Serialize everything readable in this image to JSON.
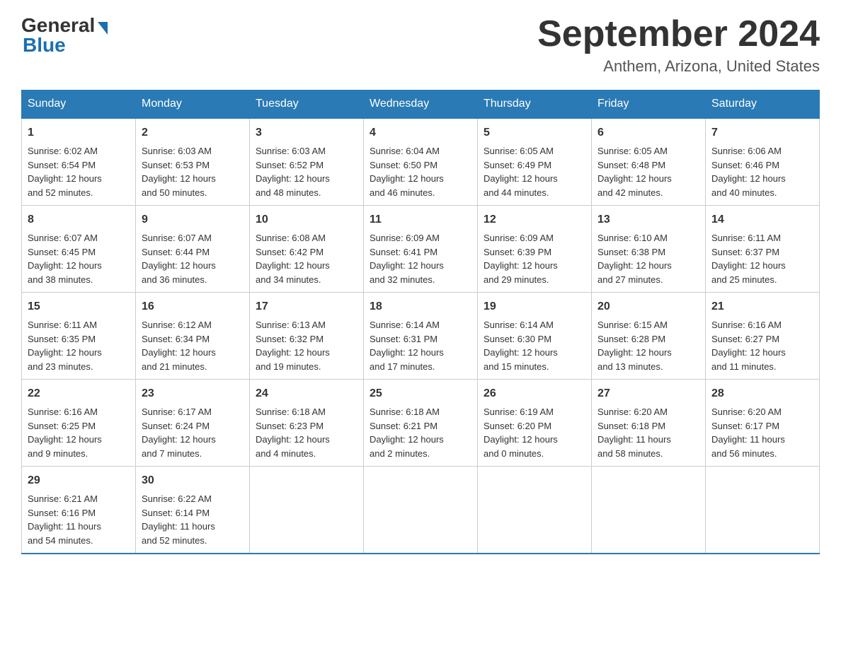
{
  "header": {
    "logo_general": "General",
    "logo_blue": "Blue",
    "title": "September 2024",
    "subtitle": "Anthem, Arizona, United States"
  },
  "days_of_week": [
    "Sunday",
    "Monday",
    "Tuesday",
    "Wednesday",
    "Thursday",
    "Friday",
    "Saturday"
  ],
  "weeks": [
    [
      {
        "day": "1",
        "sunrise": "6:02 AM",
        "sunset": "6:54 PM",
        "daylight": "12 hours and 52 minutes."
      },
      {
        "day": "2",
        "sunrise": "6:03 AM",
        "sunset": "6:53 PM",
        "daylight": "12 hours and 50 minutes."
      },
      {
        "day": "3",
        "sunrise": "6:03 AM",
        "sunset": "6:52 PM",
        "daylight": "12 hours and 48 minutes."
      },
      {
        "day": "4",
        "sunrise": "6:04 AM",
        "sunset": "6:50 PM",
        "daylight": "12 hours and 46 minutes."
      },
      {
        "day": "5",
        "sunrise": "6:05 AM",
        "sunset": "6:49 PM",
        "daylight": "12 hours and 44 minutes."
      },
      {
        "day": "6",
        "sunrise": "6:05 AM",
        "sunset": "6:48 PM",
        "daylight": "12 hours and 42 minutes."
      },
      {
        "day": "7",
        "sunrise": "6:06 AM",
        "sunset": "6:46 PM",
        "daylight": "12 hours and 40 minutes."
      }
    ],
    [
      {
        "day": "8",
        "sunrise": "6:07 AM",
        "sunset": "6:45 PM",
        "daylight": "12 hours and 38 minutes."
      },
      {
        "day": "9",
        "sunrise": "6:07 AM",
        "sunset": "6:44 PM",
        "daylight": "12 hours and 36 minutes."
      },
      {
        "day": "10",
        "sunrise": "6:08 AM",
        "sunset": "6:42 PM",
        "daylight": "12 hours and 34 minutes."
      },
      {
        "day": "11",
        "sunrise": "6:09 AM",
        "sunset": "6:41 PM",
        "daylight": "12 hours and 32 minutes."
      },
      {
        "day": "12",
        "sunrise": "6:09 AM",
        "sunset": "6:39 PM",
        "daylight": "12 hours and 29 minutes."
      },
      {
        "day": "13",
        "sunrise": "6:10 AM",
        "sunset": "6:38 PM",
        "daylight": "12 hours and 27 minutes."
      },
      {
        "day": "14",
        "sunrise": "6:11 AM",
        "sunset": "6:37 PM",
        "daylight": "12 hours and 25 minutes."
      }
    ],
    [
      {
        "day": "15",
        "sunrise": "6:11 AM",
        "sunset": "6:35 PM",
        "daylight": "12 hours and 23 minutes."
      },
      {
        "day": "16",
        "sunrise": "6:12 AM",
        "sunset": "6:34 PM",
        "daylight": "12 hours and 21 minutes."
      },
      {
        "day": "17",
        "sunrise": "6:13 AM",
        "sunset": "6:32 PM",
        "daylight": "12 hours and 19 minutes."
      },
      {
        "day": "18",
        "sunrise": "6:14 AM",
        "sunset": "6:31 PM",
        "daylight": "12 hours and 17 minutes."
      },
      {
        "day": "19",
        "sunrise": "6:14 AM",
        "sunset": "6:30 PM",
        "daylight": "12 hours and 15 minutes."
      },
      {
        "day": "20",
        "sunrise": "6:15 AM",
        "sunset": "6:28 PM",
        "daylight": "12 hours and 13 minutes."
      },
      {
        "day": "21",
        "sunrise": "6:16 AM",
        "sunset": "6:27 PM",
        "daylight": "12 hours and 11 minutes."
      }
    ],
    [
      {
        "day": "22",
        "sunrise": "6:16 AM",
        "sunset": "6:25 PM",
        "daylight": "12 hours and 9 minutes."
      },
      {
        "day": "23",
        "sunrise": "6:17 AM",
        "sunset": "6:24 PM",
        "daylight": "12 hours and 7 minutes."
      },
      {
        "day": "24",
        "sunrise": "6:18 AM",
        "sunset": "6:23 PM",
        "daylight": "12 hours and 4 minutes."
      },
      {
        "day": "25",
        "sunrise": "6:18 AM",
        "sunset": "6:21 PM",
        "daylight": "12 hours and 2 minutes."
      },
      {
        "day": "26",
        "sunrise": "6:19 AM",
        "sunset": "6:20 PM",
        "daylight": "12 hours and 0 minutes."
      },
      {
        "day": "27",
        "sunrise": "6:20 AM",
        "sunset": "6:18 PM",
        "daylight": "11 hours and 58 minutes."
      },
      {
        "day": "28",
        "sunrise": "6:20 AM",
        "sunset": "6:17 PM",
        "daylight": "11 hours and 56 minutes."
      }
    ],
    [
      {
        "day": "29",
        "sunrise": "6:21 AM",
        "sunset": "6:16 PM",
        "daylight": "11 hours and 54 minutes."
      },
      {
        "day": "30",
        "sunrise": "6:22 AM",
        "sunset": "6:14 PM",
        "daylight": "11 hours and 52 minutes."
      },
      null,
      null,
      null,
      null,
      null
    ]
  ],
  "labels": {
    "sunrise": "Sunrise:",
    "sunset": "Sunset:",
    "daylight": "Daylight:"
  }
}
